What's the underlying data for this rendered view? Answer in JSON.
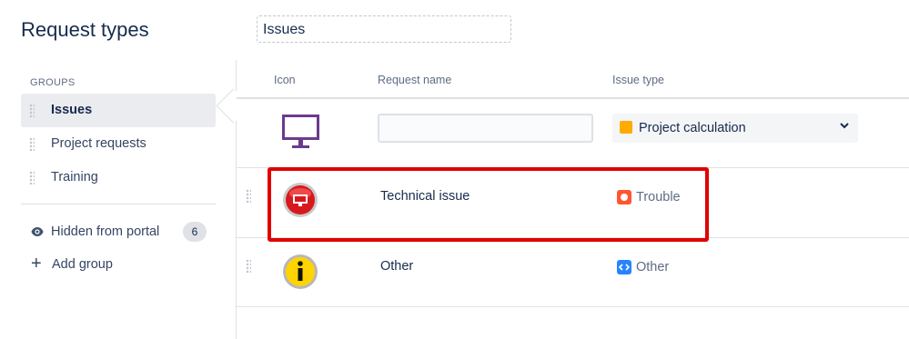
{
  "header": {
    "title": "Request types",
    "group_name_value": "Issues"
  },
  "sidebar": {
    "groups_heading": "GROUPS",
    "groups": [
      {
        "label": "Issues",
        "active": true
      },
      {
        "label": "Project requests",
        "active": false
      },
      {
        "label": "Training",
        "active": false
      }
    ],
    "hidden_label": "Hidden from portal",
    "hidden_count": "6",
    "add_group_label": "Add group"
  },
  "table": {
    "columns": {
      "icon": "Icon",
      "name": "Request name",
      "type": "Issue type"
    },
    "new_row": {
      "icon": "monitor-icon",
      "name_value": "",
      "type_selected": "Project calculation",
      "type_icon": "lightbulb-icon",
      "type_icon_color": "#ffab00"
    },
    "rows": [
      {
        "icon": "red-computer-badge-icon",
        "name": "Technical issue",
        "type": "Trouble",
        "type_color": "#ff5630",
        "highlighted": true
      },
      {
        "icon": "info-icon",
        "name": "Other",
        "type": "Other",
        "type_color": "#2684ff",
        "highlighted": false
      }
    ]
  },
  "colors": {
    "highlight": "#e00000",
    "active_group_bg": "#ebecf0",
    "text": "#172b4d",
    "muted": "#5e6c84"
  }
}
